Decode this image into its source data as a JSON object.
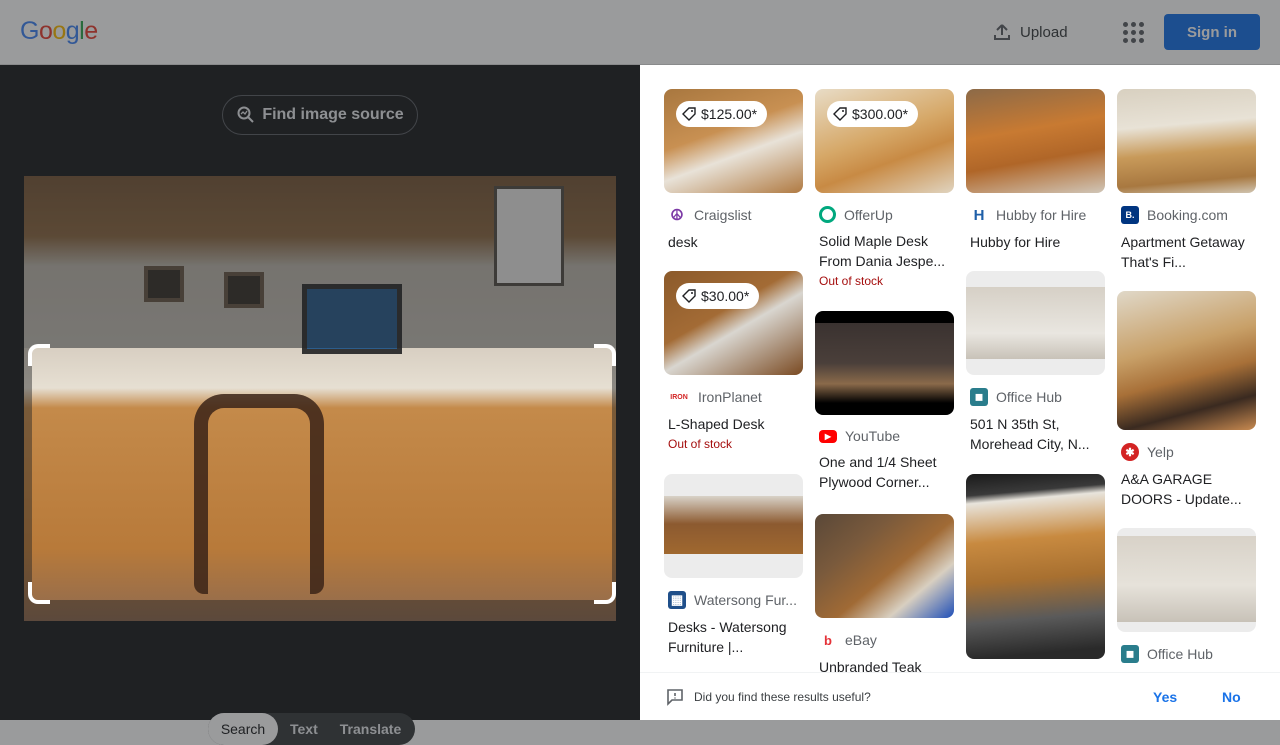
{
  "header": {
    "logo": [
      "G",
      "o",
      "o",
      "g",
      "l",
      "e"
    ],
    "logo_colors": [
      "#4285f4",
      "#ea4335",
      "#fbbc05",
      "#4285f4",
      "#34a853",
      "#ea4335"
    ],
    "upload_label": "Upload",
    "signin_label": "Sign in"
  },
  "left": {
    "find_source_label": "Find image source",
    "modes": [
      "Search",
      "Text",
      "Translate"
    ],
    "active_mode": "Search"
  },
  "results": [
    {
      "price": "$125.00*",
      "source": "Craigslist",
      "favicon_color": "#7c3aa6",
      "favicon_glyph": "☮",
      "title": "desk",
      "out_of_stock": ""
    },
    {
      "price": "$300.00*",
      "source": "OfferUp",
      "favicon_color": "#00a87e",
      "favicon_glyph": "◯",
      "title": "Solid Maple Desk From Dania Jespe...",
      "out_of_stock": "Out of stock"
    },
    {
      "price": "",
      "source": "Hubby for Hire",
      "favicon_color": "#1f5fa8",
      "favicon_glyph": "H",
      "title": "Hubby for Hire",
      "out_of_stock": ""
    },
    {
      "price": "",
      "source": "Booking.com",
      "favicon_color": "#003580",
      "favicon_glyph": "B.",
      "title": "Apartment Getaway That's Fi...",
      "out_of_stock": ""
    },
    {
      "price": "$30.00*",
      "source": "IronPlanet",
      "favicon_color": "#ffffff",
      "favicon_glyph": "IRON",
      "title": "L-Shaped Desk",
      "out_of_stock": "Out of stock"
    },
    {
      "price": "",
      "source": "YouTube",
      "favicon_color": "#ff0000",
      "favicon_glyph": "▶",
      "title": "One and 1/4 Sheet Plywood Corner...",
      "out_of_stock": ""
    },
    {
      "price": "",
      "source": "Office Hub",
      "favicon_color": "#2a7d8c",
      "favicon_glyph": "◼",
      "title": "501 N 35th St, Morehead City, N...",
      "out_of_stock": ""
    },
    {
      "price": "",
      "source": "Yelp",
      "favicon_color": "#d32323",
      "favicon_glyph": "✱",
      "title": "A&A GARAGE DOORS - Update...",
      "out_of_stock": ""
    },
    {
      "price": "",
      "source": "Watersong Fur...",
      "favicon_color": "#1f4f8a",
      "favicon_glyph": "▦",
      "title": "Desks - Watersong Furniture |...",
      "out_of_stock": ""
    },
    {
      "price": "",
      "source": "eBay",
      "favicon_color": "#f5af02",
      "favicon_glyph": "b",
      "title": "Unbranded Teak",
      "out_of_stock": ""
    },
    {
      "price": "",
      "source": "Office Hub",
      "favicon_color": "#2a7d8c",
      "favicon_glyph": "◼",
      "title": "",
      "out_of_stock": ""
    }
  ],
  "feedback": {
    "question": "Did you find these results useful?",
    "yes": "Yes",
    "no": "No"
  }
}
